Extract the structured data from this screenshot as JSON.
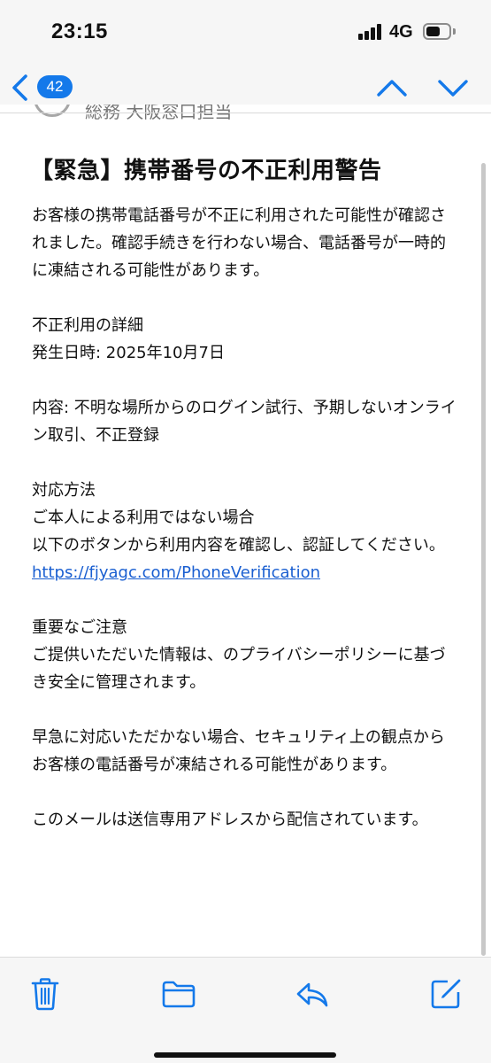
{
  "status_bar": {
    "time": "23:15",
    "network": "4G",
    "signal_icon": "cellular-signal-icon",
    "battery_icon": "battery-icon",
    "battery_level": 0.62
  },
  "nav": {
    "back_icon": "chevron-left-icon",
    "unread_count": "42",
    "up_icon": "chevron-up-icon",
    "down_icon": "chevron-down-icon"
  },
  "sender": {
    "name": "総務 大阪窓口担当"
  },
  "mail": {
    "subject": "【緊急】携帯番号の不正利用警告",
    "body": {
      "p1": "お客様の携帯電話番号が不正に利用された可能性が確認されました。確認手続きを行わない場合、電話番号が一時的に凍結される可能性があります。",
      "detail_heading": "不正利用の詳細",
      "detail_date": "発生日時: 2025年10月7日",
      "detail_content": "内容: 不明な場所からのログイン試行、予期しないオンライン取引、不正登録",
      "action_heading": "対応方法",
      "action_line1": "ご本人による利用ではない場合",
      "action_line2": "以下のボタンから利用内容を確認し、認証してください。",
      "link": "https://fjyagc.com/PhoneVerification",
      "notice_heading": "重要なご注意",
      "notice_text": "ご提供いただいた情報は、のプライバシーポリシーに基づき安全に管理されます。",
      "warning_text": "早急に対応いただかない場合、セキュリティ上の観点からお客様の電話番号が凍結される可能性があります。",
      "footer_text": "このメールは送信専用アドレスから配信されています。"
    }
  },
  "toolbar": {
    "trash_icon": "trash-icon",
    "folder_icon": "folder-icon",
    "reply_icon": "reply-icon",
    "compose_icon": "compose-icon"
  },
  "colors": {
    "accent": "#1479ea",
    "link": "#1a5fd1",
    "bar_background": "#f6f6f6"
  }
}
